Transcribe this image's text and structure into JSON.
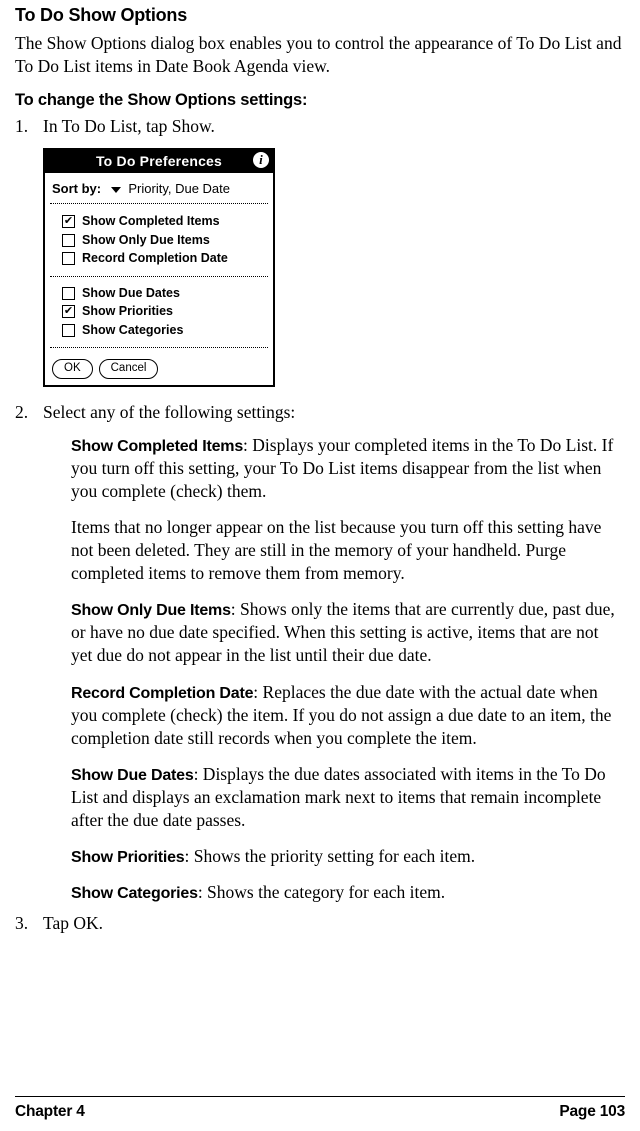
{
  "heading1": "To Do Show Options",
  "intro": "The Show Options dialog box enables you to control the appearance of To Do List and To Do List items in Date Book Agenda view.",
  "heading2": "To change the Show Options settings:",
  "step1_num": "1.",
  "step1_text": "In To Do List, tap Show.",
  "dialog": {
    "title": "To Do Preferences",
    "sort_label": "Sort by:",
    "sort_value": "Priority, Due Date",
    "items": [
      {
        "checked": true,
        "label": "Show Completed Items"
      },
      {
        "checked": false,
        "label": "Show Only Due Items"
      },
      {
        "checked": false,
        "label": "Record Completion Date"
      }
    ],
    "items2": [
      {
        "checked": false,
        "label": "Show Due Dates"
      },
      {
        "checked": true,
        "label": "Show Priorities"
      },
      {
        "checked": false,
        "label": "Show Categories"
      }
    ],
    "ok": "OK",
    "cancel": "Cancel"
  },
  "step2_num": "2.",
  "step2_text": "Select any of the following settings:",
  "settings": [
    {
      "bold": "Show Completed Items",
      "text": ": Displays your completed items in the To Do List. If you turn off this setting, your To Do List items disappear from the list when you complete (check) them."
    },
    {
      "bold": "",
      "text": "Items that no longer appear on the list because you turn off this setting have not been deleted. They are still in the memory of your handheld. Purge completed items to remove them from memory."
    },
    {
      "bold": "Show Only Due Items",
      "text": ": Shows only the items that are currently due, past due, or have no due date specified. When this setting is active, items that are not yet due do not appear in the list until their due date."
    },
    {
      "bold": "Record Completion Date",
      "text": ": Replaces the due date with the actual date when you complete (check) the item. If you do not assign a due date to an item, the completion date still records when you complete the item."
    },
    {
      "bold": "Show Due Dates",
      "text": ": Displays the due dates associated with items in the To Do List and displays an exclamation mark next to items that remain incomplete after the due date passes."
    },
    {
      "bold": "Show Priorities",
      "text": ": Shows the priority setting for each item."
    },
    {
      "bold": "Show Categories",
      "text": ": Shows the category for each item."
    }
  ],
  "step3_num": "3.",
  "step3_text": "Tap OK.",
  "footer_left": "Chapter 4",
  "footer_right": "Page 103"
}
